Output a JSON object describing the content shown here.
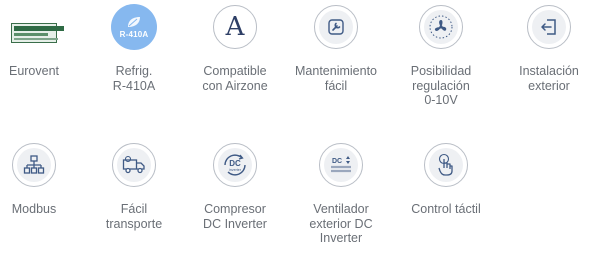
{
  "features": [
    {
      "label": "Eurovent",
      "icon": "eurovent-logo"
    },
    {
      "label": "Refrig.\nR-410A",
      "icon": "refrigerant-r410a-icon",
      "badge_text": "R-410A",
      "badge_color": "#86b8ef"
    },
    {
      "label": "Compatible\ncon Airzone",
      "icon": "airzone-a-icon",
      "glyph": "A"
    },
    {
      "label": "Mantenimiento\nfácil",
      "icon": "wrench-icon"
    },
    {
      "label": "Posibilidad\nregulación\n0-10V",
      "icon": "fan-regulation-icon"
    },
    {
      "label": "Instalación\nexterior",
      "icon": "exterior-door-icon"
    },
    {
      "label": "Modbus",
      "icon": "network-modbus-icon"
    },
    {
      "label": "Fácil\ntransporte",
      "icon": "truck-icon"
    },
    {
      "label": "Compresor\nDC Inverter",
      "icon": "dc-inverter-compressor-icon",
      "badge_text": "DC",
      "badge_sub": "inverter"
    },
    {
      "label": "Ventilador\nexterior DC\nInverter",
      "icon": "dc-inverter-fan-icon",
      "badge_text": "DC",
      "badge_sub": "inverter\nexterior"
    },
    {
      "label": "Control táctil",
      "icon": "touch-control-icon"
    }
  ],
  "colors": {
    "label_text": "#6a6f76",
    "icon_stroke": "#3f5a85",
    "circle_border": "#b9bec6",
    "accent_blue": "#86b8ef",
    "eurovent_green": "#2f6b45"
  }
}
